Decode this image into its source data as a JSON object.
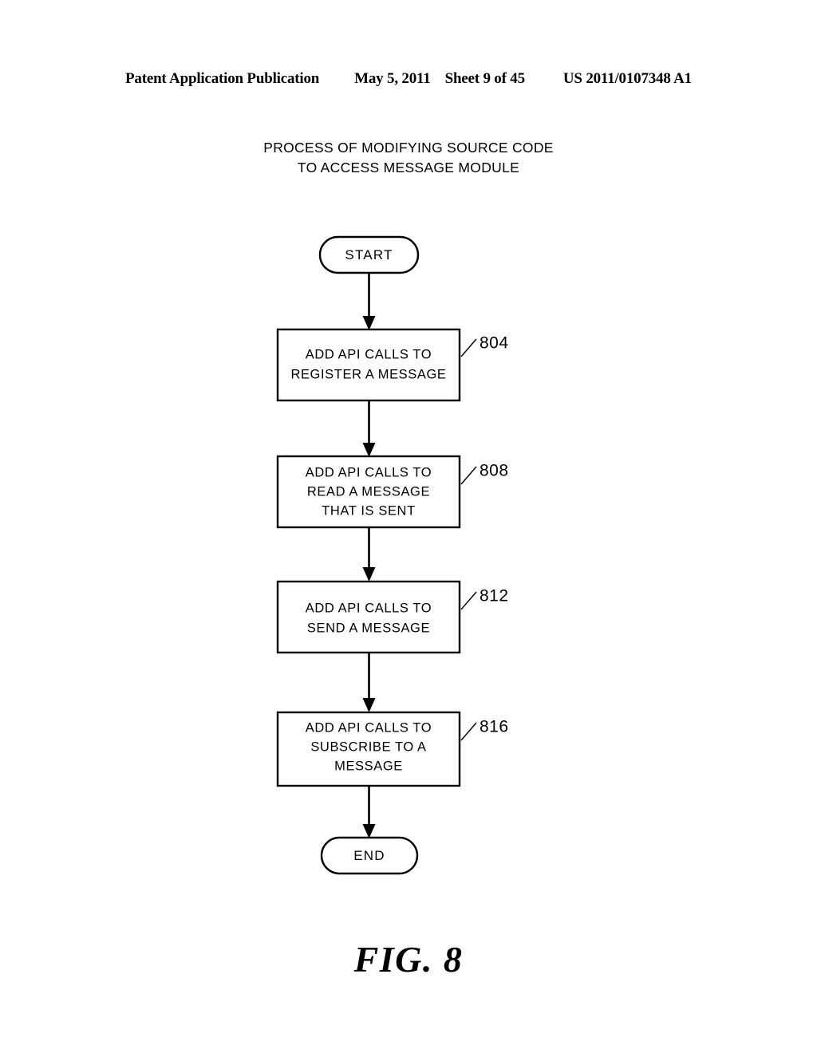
{
  "header": {
    "publication": "Patent Application Publication",
    "date": "May 5, 2011",
    "sheet": "Sheet 9 of 45",
    "document_number": "US 2011/0107348 A1"
  },
  "figure": {
    "title_line_1": "PROCESS OF MODIFYING SOURCE CODE",
    "title_line_2": "TO ACCESS MESSAGE MODULE",
    "caption": "FIG. 8"
  },
  "flowchart": {
    "type": "flowchart",
    "orientation": "vertical",
    "stroke_color": "#000000",
    "fill_color": "#ffffff",
    "start": {
      "label": "START",
      "shape": "stadium"
    },
    "end": {
      "label": "END",
      "shape": "stadium"
    },
    "steps": [
      {
        "ref": "804",
        "shape": "rectangle",
        "lines": [
          "ADD API CALLS TO",
          "REGISTER A MESSAGE"
        ]
      },
      {
        "ref": "808",
        "shape": "rectangle",
        "lines": [
          "ADD API CALLS TO",
          "READ A MESSAGE",
          "THAT IS SENT"
        ]
      },
      {
        "ref": "812",
        "shape": "rectangle",
        "lines": [
          "ADD API CALLS TO",
          "SEND A MESSAGE"
        ]
      },
      {
        "ref": "816",
        "shape": "rectangle",
        "lines": [
          "ADD API CALLS TO",
          "SUBSCRIBE TO A",
          "MESSAGE"
        ]
      }
    ],
    "connectors": [
      {
        "from": "START",
        "to": "804",
        "arrow": true
      },
      {
        "from": "804",
        "to": "808",
        "arrow": true
      },
      {
        "from": "808",
        "to": "812",
        "arrow": true
      },
      {
        "from": "812",
        "to": "816",
        "arrow": true
      },
      {
        "from": "816",
        "to": "END",
        "arrow": true
      }
    ]
  }
}
